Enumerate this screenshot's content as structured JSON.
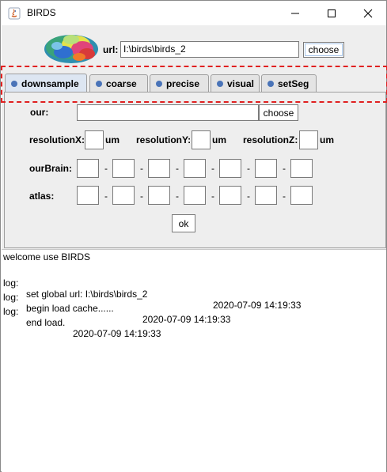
{
  "window": {
    "title": "BIRDS"
  },
  "header": {
    "url_label": "url:",
    "url_value": "I:\\birds\\birds_2",
    "choose_label": "choose"
  },
  "tabs": [
    {
      "label": "downsample",
      "active": true
    },
    {
      "label": "coarse",
      "active": false
    },
    {
      "label": "precise",
      "active": false
    },
    {
      "label": "visual",
      "active": false
    },
    {
      "label": "setSeg",
      "active": false
    }
  ],
  "downsample": {
    "our_label": "our:",
    "our_value": "",
    "choose_label": "choose",
    "resolutionX_label": "resolutionX:",
    "resolutionY_label": "resolutionY:",
    "resolutionZ_label": "resolutionZ:",
    "unit": "um",
    "ourBrain_label": "ourBrain:",
    "atlas_label": "atlas:",
    "separator": "-",
    "ok_label": "ok"
  },
  "log": {
    "welcome": "welcome use BIRDS",
    "entries": [
      {
        "tag": "log:",
        "message": "set global url: I:\\birds\\birds_2",
        "timestamp": "2020-07-09 14:19:33"
      },
      {
        "tag": "log:",
        "message": "begin load cache......",
        "timestamp": "2020-07-09 14:19:33"
      },
      {
        "tag": "log:",
        "message": "end load.",
        "timestamp": "2020-07-09 14:19:33"
      }
    ]
  },
  "colors": {
    "tab_dot": "#4a74b8",
    "highlight": "#e02020",
    "panel_bg": "#eeeeee"
  }
}
